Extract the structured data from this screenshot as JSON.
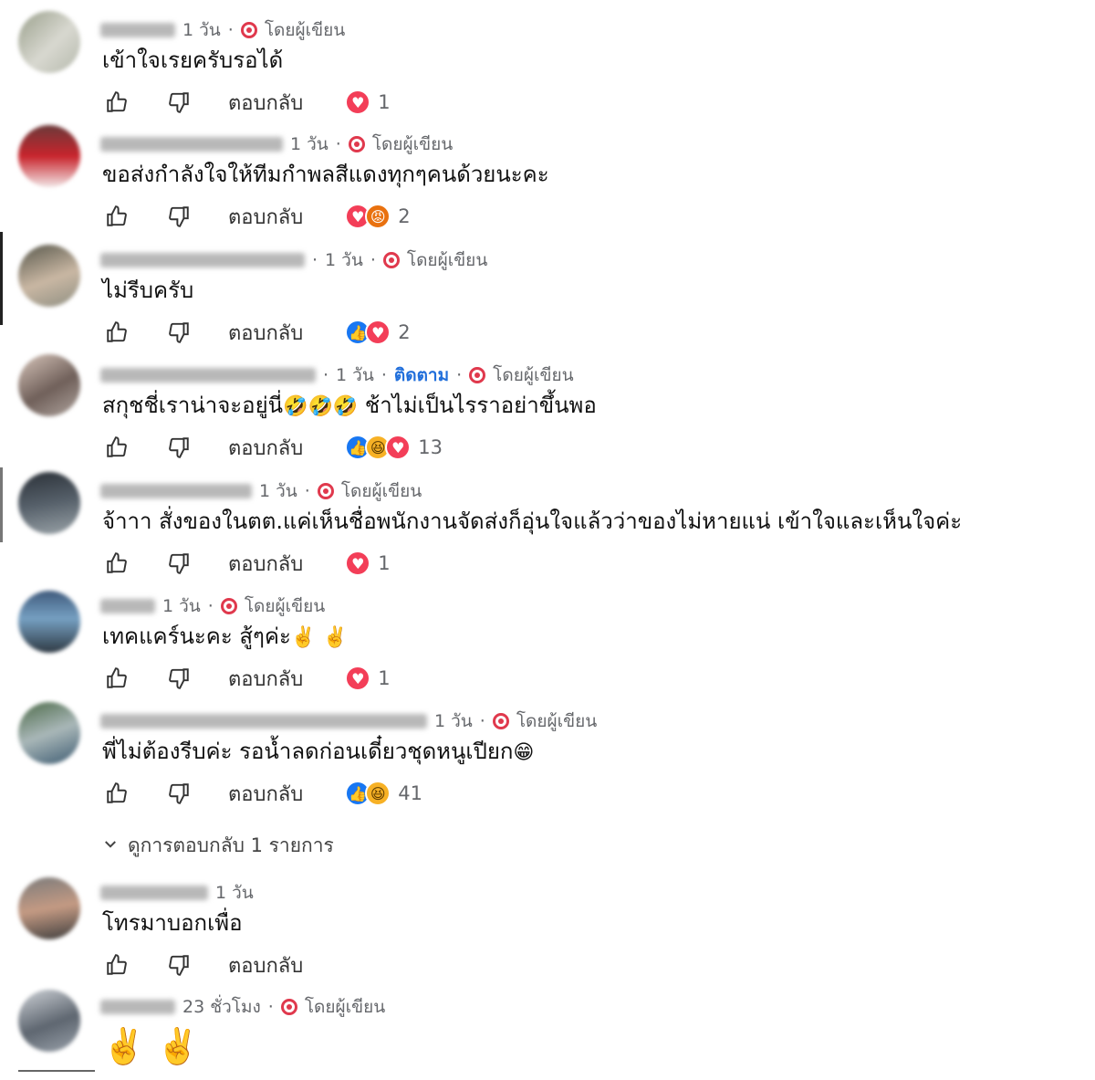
{
  "labels": {
    "reply": "ตอบกลับ",
    "author_badge": "โดยผู้เขียน",
    "follow": "ติดตาม",
    "view_replies": "ดูการตอบกลับ 1 รายการ"
  },
  "icons": {
    "like": "thumbs-up-icon",
    "dislike": "thumbs-down-icon",
    "expand": "chevron-down-icon",
    "author_badge": "heart-badge-icon"
  },
  "colors": {
    "love": "#f33e58",
    "like": "#1877f2",
    "haha": "#f7b125",
    "follow": "#216fdb"
  },
  "comments": [
    {
      "time": "1 วัน",
      "author_badge": true,
      "text": "เข้าใจเรยครับรอได้",
      "reactions": [
        "love"
      ],
      "count": "1"
    },
    {
      "time": "1 วัน",
      "author_badge": true,
      "text": "ขอส่งกำลังใจให้ทีมกำพลสีแดงทุกๆคนด้วยนะคะ",
      "reactions": [
        "love",
        "angry"
      ],
      "count": "2"
    },
    {
      "time": "1 วัน",
      "author_badge": true,
      "text": "ไม่รีบครับ",
      "reactions": [
        "like",
        "love"
      ],
      "count": "2"
    },
    {
      "time": "1 วัน",
      "follow": true,
      "author_badge": true,
      "text": "สกุชชี่เราน่าจะอยู่นี่",
      "text_after_emoji": "ช้าไม่เป็นไรราอย่าขึ้นพอ",
      "emojis": [
        "🤣",
        "🤣",
        "🤣"
      ],
      "reactions": [
        "like",
        "haha",
        "love"
      ],
      "count": "13"
    },
    {
      "time": "1 วัน",
      "author_badge": true,
      "text": "จ้าาา สั่งของในตต.แค่เห็นชื่อพนักงานจัดส่งก็อุ่นใจแล้วว่าของไม่หายแน่ เข้าใจและเห็นใจค่ะ",
      "reactions": [
        "love"
      ],
      "count": "1"
    },
    {
      "time": "1 วัน",
      "author_badge": true,
      "text": "เทคแคร์นะคะ สู้ๆค่ะ",
      "emojis": [
        "✌️",
        "✌️"
      ],
      "reactions": [
        "love"
      ],
      "count": "1"
    },
    {
      "time": "1 วัน",
      "author_badge": true,
      "text": "พี่ไม่ต้องรีบค่ะ รอน้ำลดก่อนเดี๋ยวชุดหนูเปียก",
      "emojis": [
        "😁"
      ],
      "reactions": [
        "like",
        "haha"
      ],
      "count": "41"
    },
    {
      "time": "1 วัน",
      "author_badge": false,
      "text": "โทรมาบอกเพื่อ",
      "reactions": [],
      "count": ""
    },
    {
      "time": "23 ชั่วโมง",
      "author_badge": true,
      "text": "",
      "emojis": [
        "✌️",
        "✌️"
      ]
    }
  ]
}
